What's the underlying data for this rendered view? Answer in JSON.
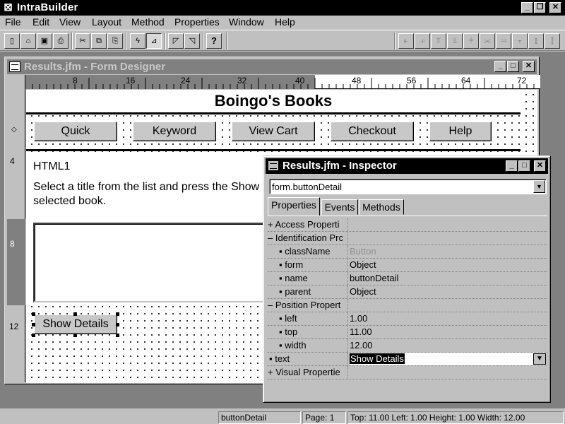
{
  "app": {
    "title": "IntraBuilder",
    "menu": [
      "File",
      "Edit",
      "View",
      "Layout",
      "Method",
      "Properties",
      "Window",
      "Help"
    ]
  },
  "toolbar": {
    "help_label": "?"
  },
  "designer": {
    "title": "Results.jfm - Form Designer",
    "ruler_h": [
      "8",
      "16",
      "24",
      "32",
      "40",
      "48",
      "56",
      "64",
      "72"
    ],
    "ruler_v": [
      "4",
      "8",
      "12"
    ],
    "form": {
      "heading": "Boingo's Books",
      "nav_buttons": [
        "Quick",
        "Keyword",
        "View Cart",
        "Checkout",
        "Help"
      ],
      "html_label": "HTML1",
      "instruction_line1": "Select a title from the list and press the Show",
      "instruction_line2": "selected book.",
      "detail_button": "Show Details"
    }
  },
  "inspector": {
    "title": "Results.jfm - Inspector",
    "selected_object": "form.buttonDetail",
    "tabs": [
      "Properties",
      "Events",
      "Methods"
    ],
    "rows": [
      {
        "name": "+ Access Properti",
        "value": ""
      },
      {
        "name": "– Identification Prc",
        "value": ""
      },
      {
        "name": "▪ className",
        "value": "Button"
      },
      {
        "name": "▪ form",
        "value": "Object"
      },
      {
        "name": "▪ name",
        "value": "buttonDetail"
      },
      {
        "name": "▪ parent",
        "value": "Object"
      },
      {
        "name": "– Position Propert",
        "value": ""
      },
      {
        "name": "▪ left",
        "value": "1.00"
      },
      {
        "name": "▪ top",
        "value": "11.00"
      },
      {
        "name": "▪ width",
        "value": "12.00"
      },
      {
        "name": "▪ text",
        "value": "Show Details"
      },
      {
        "name": "+ Visual Propertie",
        "value": ""
      }
    ]
  },
  "statusbar": {
    "object": "buttonDetail",
    "page": "Page: 1",
    "geometry": "Top: 11.00 Left: 1.00 Height: 1.00 Width: 12.00"
  }
}
